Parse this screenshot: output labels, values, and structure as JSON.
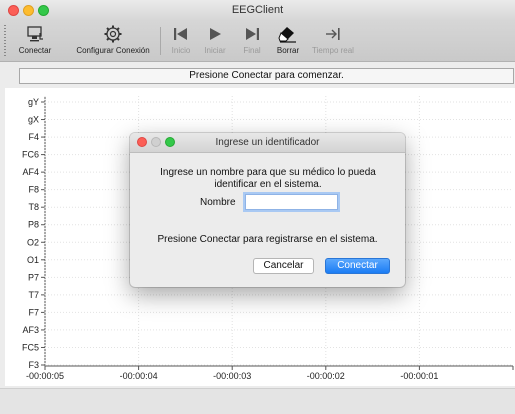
{
  "window": {
    "title": "EEGClient"
  },
  "toolbar": {
    "items": [
      {
        "label": "Conectar",
        "icon": "connect-icon",
        "enabled": true
      },
      {
        "label": "Configurar Conexión",
        "icon": "gear-icon",
        "enabled": true
      },
      {
        "label": "Inicio",
        "icon": "skip-start-icon",
        "enabled": false
      },
      {
        "label": "Iniciar",
        "icon": "play-icon",
        "enabled": false
      },
      {
        "label": "Final",
        "icon": "skip-end-icon",
        "enabled": false
      },
      {
        "label": "Borrar",
        "icon": "eraser-icon",
        "enabled": true
      },
      {
        "label": "Tiempo real",
        "icon": "arrow-right-bar-icon",
        "enabled": false
      }
    ]
  },
  "status": {
    "text": "Presione Conectar para comenzar."
  },
  "plot": {
    "channels": [
      "gY",
      "gX",
      "F4",
      "FC6",
      "AF4",
      "F8",
      "T8",
      "P8",
      "O2",
      "O1",
      "P7",
      "T7",
      "F7",
      "AF3",
      "FC5",
      "F3"
    ],
    "time_ticks": [
      "-00:00:05",
      "-00:00:04",
      "-00:00:03",
      "-00:00:02",
      "-00:00:01"
    ]
  },
  "dialog": {
    "title": "Ingrese un identificador",
    "message": "Ingrese un nombre para que su médico lo pueda identificar en el sistema.",
    "name_label": "Nombre",
    "name_value": "",
    "hint": "Presione Conectar para registrarse en el sistema.",
    "cancel_label": "Cancelar",
    "ok_label": "Conectar"
  },
  "colors": {
    "accent": "#1b7cf4",
    "close": "#fc5f57",
    "minimize": "#fdbc2e",
    "maximize": "#34c84a"
  }
}
